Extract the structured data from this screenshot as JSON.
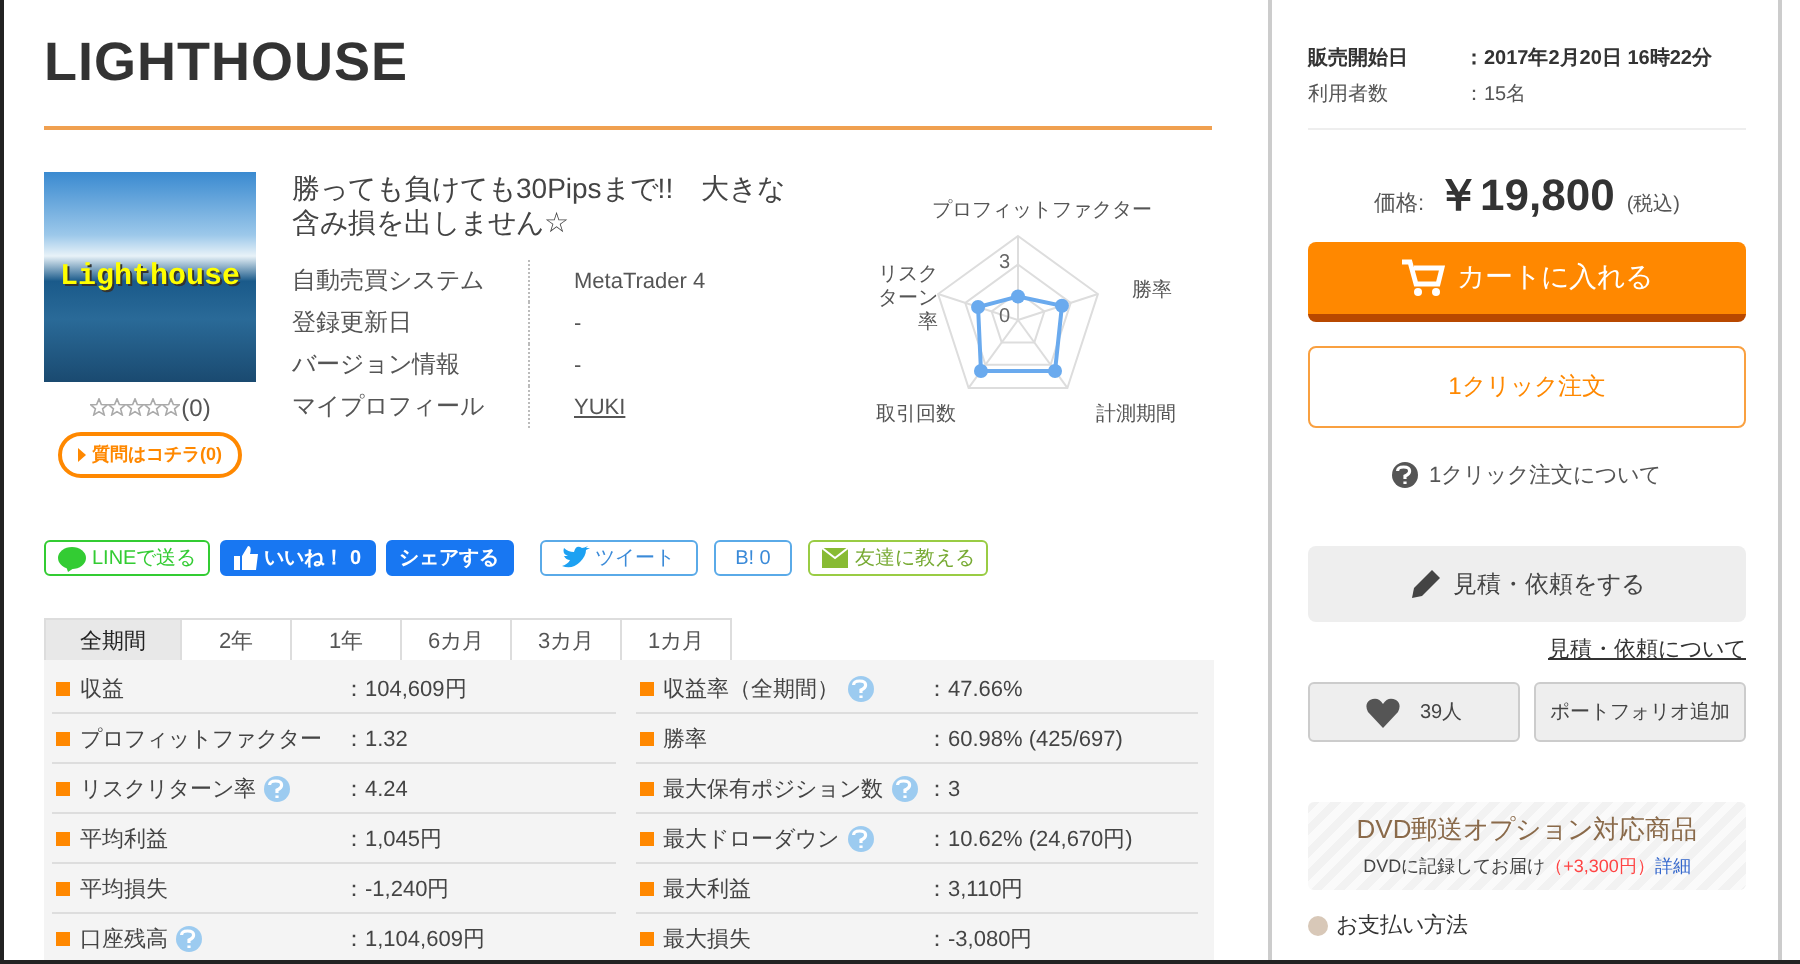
{
  "title": "LIGHTHOUSE",
  "product": {
    "image_caption": "Lighthouse",
    "headline": "勝っても負けても30Pipsまで!!　大きな含み損を出しません☆",
    "stars": 0,
    "review_count": "(0)",
    "question_button": "質問はコチラ(0)",
    "specs": [
      {
        "label": "自動売買システム",
        "value": "MetaTrader 4",
        "link": false
      },
      {
        "label": "登録更新日",
        "value": "-",
        "link": false
      },
      {
        "label": "バージョン情報",
        "value": "-",
        "link": false
      },
      {
        "label": "マイプロフィール",
        "value": "YUKI",
        "link": true
      }
    ]
  },
  "radar": {
    "axes": [
      "プロフィットファクター",
      "勝率",
      "計測期間",
      "取引回数",
      "リスクターン率"
    ],
    "ticks": [
      "3",
      "0"
    ]
  },
  "share": [
    {
      "kind": "line",
      "label": "LINEで送る"
    },
    {
      "kind": "fb-like",
      "label": "いいね！ 0"
    },
    {
      "kind": "fb-share",
      "label": "シェアする"
    },
    {
      "kind": "tweet",
      "label": "ツイート"
    },
    {
      "kind": "hatena",
      "label": "B! 0"
    },
    {
      "kind": "mail",
      "label": "友達に教える"
    }
  ],
  "tabs": [
    {
      "label": "全期間",
      "selected": true
    },
    {
      "label": "2年",
      "selected": false
    },
    {
      "label": "1年",
      "selected": false
    },
    {
      "label": "6カ月",
      "selected": false
    },
    {
      "label": "3カ月",
      "selected": false
    },
    {
      "label": "1カ月",
      "selected": false
    }
  ],
  "stats": [
    {
      "label": "収益",
      "help": false,
      "value": "：104,609円"
    },
    {
      "label": "収益率（全期間）",
      "help": true,
      "value": "：47.66%"
    },
    {
      "label": "プロフィットファクター",
      "help": false,
      "value": "：1.32"
    },
    {
      "label": "勝率",
      "help": false,
      "value": "：60.98% (425/697)"
    },
    {
      "label": "リスクリターン率",
      "help": true,
      "value": "：4.24"
    },
    {
      "label": "最大保有ポジション数",
      "help": true,
      "value": "：3"
    },
    {
      "label": "平均利益",
      "help": false,
      "value": "：1,045円"
    },
    {
      "label": "最大ドローダウン",
      "help": true,
      "value": "：10.62% (24,670円)"
    },
    {
      "label": "平均損失",
      "help": false,
      "value": "：-1,240円"
    },
    {
      "label": "最大利益",
      "help": false,
      "value": "：3,110円"
    },
    {
      "label": "口座残高",
      "help": true,
      "value": "：1,104,609円"
    },
    {
      "label": "最大損失",
      "help": false,
      "value": "：-3,080円"
    }
  ],
  "sidebar": {
    "info": [
      {
        "label": "販売開始日",
        "value": "：2017年2月20日 16時22分",
        "bold": true
      },
      {
        "label": "利用者数",
        "value": "：15名",
        "bold": false
      }
    ],
    "price_label": "価格:",
    "price": "￥19,800",
    "tax": "(税込)",
    "cart_button": "カートに入れる",
    "one_click_button": "1クリック注文",
    "one_click_help": "1クリック注文について",
    "estimate_button": "見積・依頼をする",
    "estimate_link": "見積・依頼について",
    "favorite_button": "39人",
    "portfolio_button": "ポートフォリオ追加",
    "dvd": {
      "title": "DVD郵送オプション対応商品",
      "text": "DVDに記録してお届け",
      "price": "（+3,300円）",
      "link": "詳細"
    },
    "payment": "お支払い方法"
  }
}
